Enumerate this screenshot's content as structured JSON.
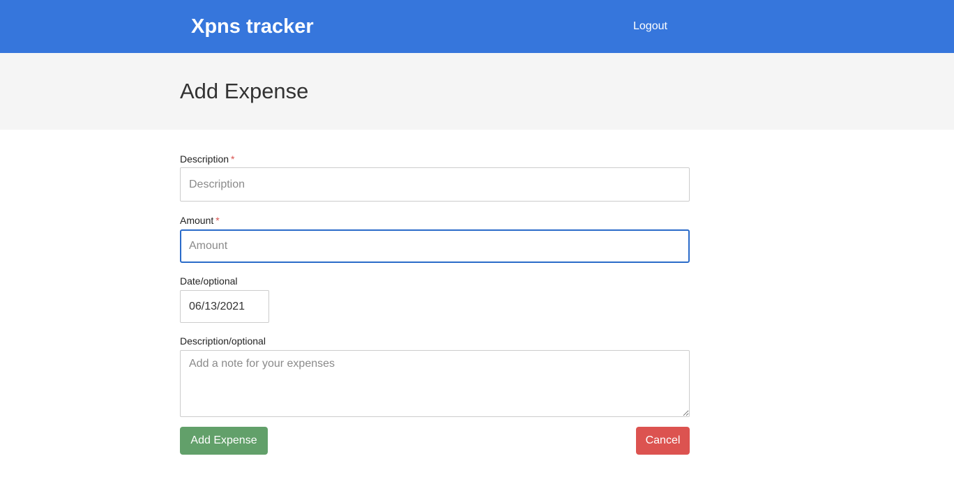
{
  "navbar": {
    "brand": "Xpns tracker",
    "logout_label": "Logout",
    "background_color": "#3676dc"
  },
  "header": {
    "title": "Add Expense"
  },
  "form": {
    "description": {
      "label": "Description",
      "required_marker": "*",
      "value": "",
      "placeholder": "Description"
    },
    "amount": {
      "label": "Amount",
      "required_marker": "*",
      "value": "",
      "placeholder": "Amount",
      "focused": true
    },
    "date": {
      "label": "Date/optional",
      "value": "06/13/2021"
    },
    "note": {
      "label": "Description/optional",
      "value": "",
      "placeholder": "Add a note for your expenses"
    },
    "submit_label": "Add Expense",
    "cancel_label": "Cancel",
    "colors": {
      "submit": "#62a06a",
      "cancel": "#dc5350",
      "required": "#d9534f"
    }
  }
}
